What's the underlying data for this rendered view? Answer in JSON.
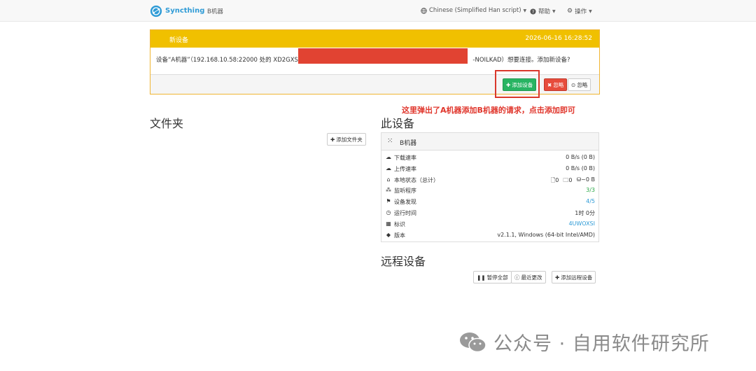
{
  "navbar": {
    "brand": "Syncthing",
    "device_name": "B机器",
    "language": "Chinese (Simplified Han script)",
    "help": "帮助",
    "actions": "操作"
  },
  "notification": {
    "title": "新设备",
    "date": "2026-06-16 16:28:52",
    "message_start": "设备“A机器”（192.168.10.58:22000 处的 XD2GXSH-",
    "message_end": "-NOILKAD）想要连接。添加新设备?",
    "add_device_label": "添加设备",
    "ignore_red_label": "忽略",
    "ignore_label": "忽略"
  },
  "annotation": "这里弹出了A机器添加B机器的请求，点击添加即可",
  "folders": {
    "title": "文件夹",
    "add_folder_label": "添加文件夹"
  },
  "this_device": {
    "title": "此设备",
    "name": "B机器",
    "rows": [
      {
        "icon": "cloud-download-icon",
        "label": "下载速率",
        "value": "0 B/s (0 B)"
      },
      {
        "icon": "cloud-upload-icon",
        "label": "上传速率",
        "value": "0 B/s (0 B)"
      },
      {
        "icon": "home-icon",
        "label": "本地状态（总计）",
        "value": ""
      },
      {
        "icon": "sitemap-icon",
        "label": "监听程序",
        "value": "3/3"
      },
      {
        "icon": "signpost-icon",
        "label": "设备发现",
        "value": "4/5"
      },
      {
        "icon": "clock-icon",
        "label": "运行时间",
        "value": "1时 0分"
      },
      {
        "icon": "qrcode-icon",
        "label": "标识",
        "value": "4UWOXSI"
      },
      {
        "icon": "tag-icon",
        "label": "版本",
        "value": "v2.1.1, Windows (64-bit Intel/AMD)"
      }
    ],
    "local_state": {
      "files": "0",
      "folders": "0",
      "size": "~0 B"
    }
  },
  "remote_devices": {
    "title": "远程设备",
    "pause_all_label": "暂停全部",
    "recent_changes_label": "最近更改",
    "add_remote_label": "添加远程设备"
  },
  "watermark": {
    "text": "公众号 · 自用软件研究所"
  },
  "colors": {
    "brand_blue": "#2f9bd6",
    "warning_yellow": "#f0c000",
    "success_green": "#28b463",
    "danger_red": "#e74c3c",
    "annotation_red": "#e0352b"
  }
}
